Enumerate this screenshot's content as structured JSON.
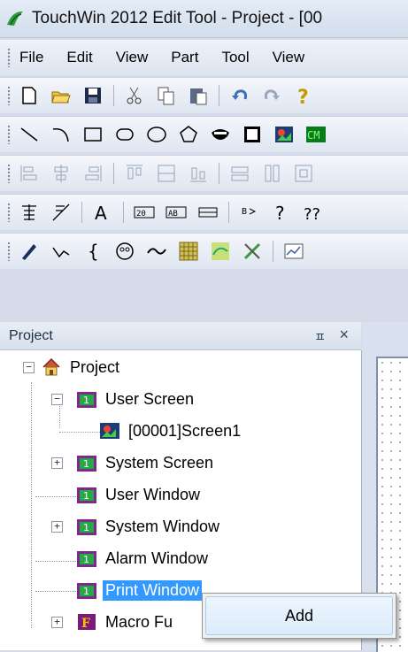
{
  "window": {
    "title": "TouchWin 2012 Edit Tool - Project - [00"
  },
  "menu": [
    "File",
    "Edit",
    "View",
    "Part",
    "Tool",
    "View"
  ],
  "toolbars": {
    "standard": [
      "new-icon",
      "open-icon",
      "save-icon",
      "cut-icon",
      "copy-icon",
      "paste-icon",
      "undo-icon",
      "redo-icon",
      "help-icon"
    ],
    "shapes": [
      "line-icon",
      "arc-icon",
      "rectangle-icon",
      "rounded-rect-icon",
      "ellipse-icon",
      "polygon-icon",
      "sector-icon",
      "frame-icon",
      "image-icon",
      "cm-icon"
    ],
    "align": [
      "align-left-icon",
      "align-center-icon",
      "align-right-icon",
      "align-top-icon",
      "align-middle-icon",
      "align-bottom-icon",
      "same-width-icon",
      "same-height-icon",
      "same-size-icon"
    ],
    "text": [
      "table-icon",
      "line-text-icon",
      "text-icon",
      "numeric-input-icon",
      "numeric-display-icon",
      "button-icon",
      "string-icon",
      "question-icon",
      "question2-icon"
    ],
    "parts": [
      "pencil-icon",
      "polyline-icon",
      "bracket-icon",
      "meter-icon",
      "trend-icon",
      "grid-icon",
      "bar-icon",
      "tools-icon",
      "chart-icon"
    ]
  },
  "panel": {
    "title": "Project",
    "pin": "ㅍ",
    "close": "×"
  },
  "tree": {
    "root": "Project",
    "user_screen": "User Screen",
    "screen1": "[00001]Screen1",
    "system_screen": "System Screen",
    "user_window": "User Window",
    "system_window": "System Window",
    "alarm_window": "Alarm Window",
    "print_window": "Print Window",
    "macro": "Macro Fu"
  },
  "context_menu": {
    "add": "Add"
  },
  "colors": {
    "selection": "#3399ff",
    "accent": "#2b4f9e"
  }
}
